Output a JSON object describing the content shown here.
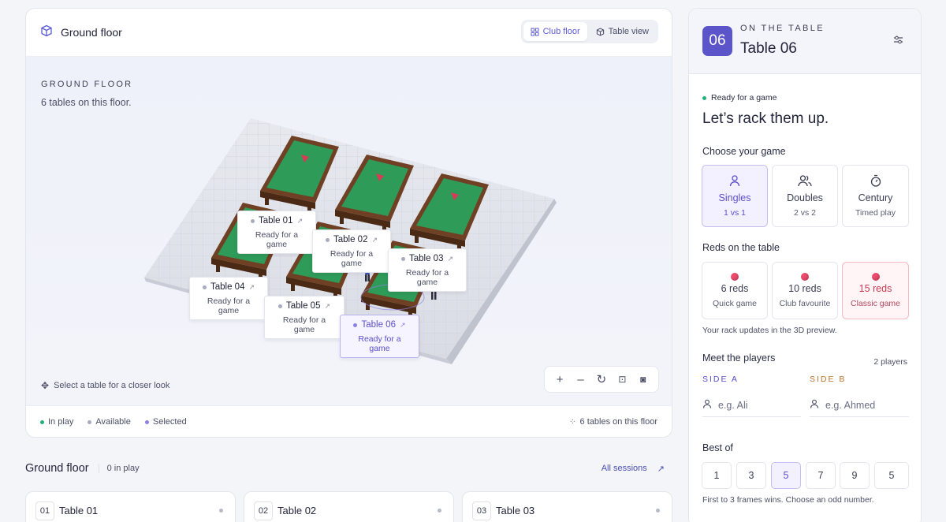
{
  "floor_panel": {
    "title": "Ground floor",
    "view_options": [
      "Club floor",
      "Table view"
    ],
    "eyebrow": "GROUND FLOOR",
    "subtitle": "6 tables on this floor.",
    "hint": "Select a table for a closer look",
    "legend": [
      {
        "label": "In play",
        "color": "#22b07a"
      },
      {
        "label": "Available",
        "color": "#a7abc0"
      },
      {
        "label": "Selected",
        "color": "#8b82e6"
      }
    ],
    "footer_count": "6 tables on this floor",
    "tables": [
      {
        "name": "Table 01",
        "status": "Ready for a game"
      },
      {
        "name": "Table 02",
        "status": "Ready for a game"
      },
      {
        "name": "Table 03",
        "status": "Ready for a game"
      },
      {
        "name": "Table 04",
        "status": "Ready for a game"
      },
      {
        "name": "Table 05",
        "status": "Ready for a game"
      },
      {
        "name": "Table 06",
        "status": "Ready for a game",
        "selected": true
      }
    ]
  },
  "side_panel": {
    "badge": "06",
    "eyebrow": "ON THE TABLE",
    "title": "Table 06",
    "status": "Ready for a game",
    "headline": "Let’s rack them up.",
    "game_label": "Choose your game",
    "games": [
      {
        "name": "Singles",
        "desc": "1 vs 1",
        "icon": "person-icon",
        "selected": true
      },
      {
        "name": "Doubles",
        "desc": "2 vs 2",
        "icon": "people-icon"
      },
      {
        "name": "Century",
        "desc": "Timed play",
        "icon": "stopwatch-icon"
      }
    ],
    "reds_label": "Reds on the table",
    "reds": [
      {
        "name": "6 reds",
        "desc": "Quick game"
      },
      {
        "name": "10 reds",
        "desc": "Club favourite"
      },
      {
        "name": "15 reds",
        "desc": "Classic game",
        "selected": true
      }
    ],
    "reds_note": "Your rack updates in the 3D preview.",
    "players_label": "Meet the players",
    "players_count": "2 players",
    "side_a": "SIDE A",
    "side_b": "SIDE B",
    "side_a_placeholder": "e.g. Ali",
    "side_b_placeholder": "e.g. Ahmed",
    "best_of_label": "Best of",
    "best_of": [
      "1",
      "3",
      "5",
      "7",
      "9",
      "5"
    ],
    "best_of_selected": "5",
    "best_of_note": "First to 3 frames wins. Choose an odd number."
  },
  "sessions": {
    "title": "Ground floor",
    "count": "0 in play",
    "all_label": "All sessions",
    "cards": [
      {
        "no": "01",
        "name": "Table 01"
      },
      {
        "no": "02",
        "name": "Table 02"
      },
      {
        "no": "03",
        "name": "Table 03"
      }
    ]
  },
  "colors": {
    "accent": "#5b4fc9",
    "felt": "#2f9b58",
    "wood": "#7a4a2a",
    "ball": "#ec4b6d"
  }
}
